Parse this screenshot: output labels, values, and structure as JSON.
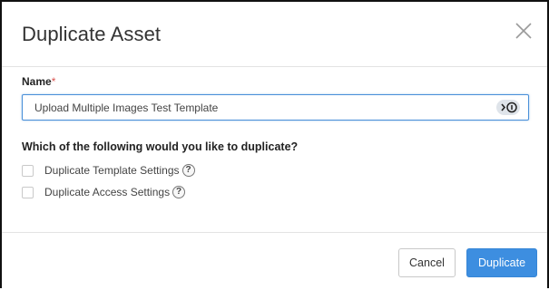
{
  "dialog": {
    "title": "Duplicate Asset",
    "close_icon": "close-icon"
  },
  "name_field": {
    "label": "Name",
    "required_marker": "*",
    "value": "Upload Multiple Images Test Template",
    "password_manager_icon": "password-manager-icon"
  },
  "duplicate_options": {
    "question": "Which of the following would you like to duplicate?",
    "items": [
      {
        "label": "Duplicate Template Settings",
        "checked": false,
        "help": "?"
      },
      {
        "label": "Duplicate Access Settings",
        "checked": false,
        "help": "?"
      }
    ]
  },
  "footer": {
    "cancel_label": "Cancel",
    "primary_label": "Duplicate"
  },
  "colors": {
    "primary": "#3d8ee0",
    "required": "#d9534f",
    "focus_border": "#4a90d9"
  }
}
